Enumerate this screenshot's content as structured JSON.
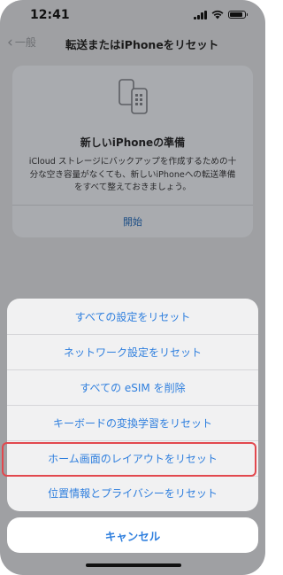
{
  "status": {
    "time": "12:41"
  },
  "nav": {
    "back_label": "一般",
    "title": "転送またはiPhoneをリセット"
  },
  "card": {
    "title": "新しいiPhoneの準備",
    "description": "iCloud ストレージにバックアップを作成するための十分な空き容量がなくても、新しいiPhoneへの転送準備をすべて整えておきましょう。",
    "link": "開始"
  },
  "sheet": {
    "actions": [
      "すべての設定をリセット",
      "ネットワーク設定をリセット",
      "すべての eSIM を削除",
      "キーボードの変換学習をリセット",
      "ホーム画面のレイアウトをリセット",
      "位置情報とプライバシーをリセット"
    ],
    "highlighted_index": 4,
    "cancel": "キャンセル"
  },
  "colors": {
    "accent": "#2f7fde",
    "highlight": "#e2484e",
    "dim_background": "#9fa0a3"
  }
}
